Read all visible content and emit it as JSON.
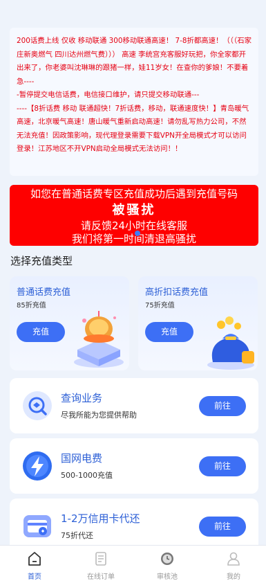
{
  "notice": {
    "paragraph1": "200话费上线 仅收 移动联通 300移动联通高速！ 7-8折都高速！（（（石家庄新奥燃气 四川达州燃气费））） 高速 李统宫充客服好玩把，你全家都开出来了，你老婆叫沈琳琳的跟猪一样，娃11岁女！在查你的爹娘！不要着急----",
    "paragraph2": "-暂停提交电信话费，电信接口维护，请只提交移动联通---",
    "paragraph3": "----【8折话费 移动 联通超快！7折话费，移动，联通速度快！】青岛暖气高速，北京暖气高速！唐山暖气重新启动高速！请勿乱写热力公司，不然无法充值！因政策影响，现代理登录需要下载VPN开全局模式才可以访问登录！江苏地区不开VPN启动全局模式无法访问！！"
  },
  "banner": {
    "line1": "如您在普通话费专区充值成功后遇到充值号码",
    "line2": "被骚扰",
    "line3": "请反馈24小时在线客服",
    "line4": "我们将第一时间清退高骚扰"
  },
  "section_title": "选择充值类型",
  "recharge_cards": [
    {
      "title": "普通话费充值",
      "subtitle": "85折充值",
      "button": "充值"
    },
    {
      "title": "高折扣话费充值",
      "subtitle": "75折充值",
      "button": "充值"
    }
  ],
  "services": [
    {
      "title": "查询业务",
      "desc": "尽我所能为您提供帮助",
      "button": "前往",
      "icon": "search-box-icon"
    },
    {
      "title": "国网电费",
      "desc": "500-1000充值",
      "button": "前往",
      "icon": "lightning-icon"
    },
    {
      "title": "1-2万信用卡代还",
      "desc": "75折代还",
      "button": "前往",
      "icon": "credit-card-icon"
    }
  ],
  "tabbar": [
    {
      "label": "首页",
      "icon": "home-icon",
      "active": true
    },
    {
      "label": "在线订单",
      "icon": "order-icon",
      "active": false
    },
    {
      "label": "审核池",
      "icon": "clock-icon",
      "active": false
    },
    {
      "label": "我的",
      "icon": "user-icon",
      "active": false
    }
  ],
  "colors": {
    "accent": "#3d6ff5",
    "notice_text": "#e60012",
    "banner_bg": "#fe0000",
    "page_bg": "#eef3fb"
  }
}
